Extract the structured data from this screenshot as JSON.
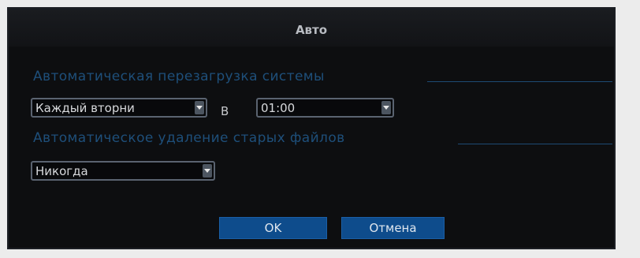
{
  "dialog": {
    "title": "Авто"
  },
  "reboot": {
    "heading": "Автоматическая перезагрузка системы",
    "day_value": "Каждый вторни",
    "at_label": "В",
    "time_value": "01:00"
  },
  "delete_files": {
    "heading": "Автоматическое удаление старых файлов",
    "value": "Никогда"
  },
  "buttons": {
    "ok_label": "OK",
    "cancel_label": "Отмена"
  },
  "colors": {
    "accent_blue": "#0e4c8c",
    "section_text": "#1e4f7a",
    "background": "#0d0e10"
  }
}
